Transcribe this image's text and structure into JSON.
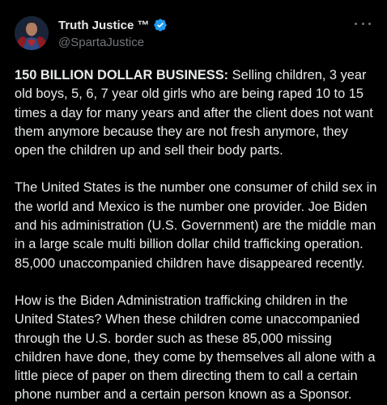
{
  "author": {
    "display_name": "Truth Justice ™",
    "handle": "@SpartaJustice",
    "avatar_icon": "superman-avatar-icon",
    "verified_icon": "verified-badge-icon",
    "verified_color": "#1d9bf0"
  },
  "menu": {
    "more_icon": "more-options-icon"
  },
  "tweet": {
    "p1_bold": "150 BILLION DOLLAR BUSINESS:",
    "p1_text": " Selling children, 3 year old boys, 5, 6, 7 year old girls who are being raped 10 to 15 times a day for many years and after the client does not want them anymore because they are not fresh anymore, they open the children up and sell their body parts.",
    "p2": "The United States is the number one consumer of child sex in the world and Mexico is the number one provider. Joe Biden and his administration (U.S. Government) are the middle man in a large scale multi billion dollar child trafficking operation. 85,000 unaccompanied children have disappeared recently.",
    "p3": "How is the Biden Administration trafficking children in the United States? When these children come unaccompanied through the U.S. border such as these 85,000 missing children have done, they come by themselves all alone with a little piece of paper on them directing them to call a certain phone number and a certain person known as a Sponsor."
  },
  "colors": {
    "background": "#000000",
    "text": "#e7e9ea",
    "muted": "#71767b"
  }
}
